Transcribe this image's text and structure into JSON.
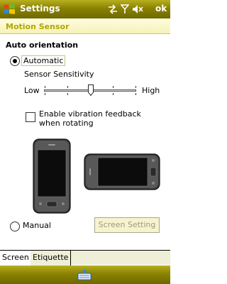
{
  "titlebar": {
    "app_title": "Settings",
    "ok_label": "ok",
    "icons": [
      "windows-start-icon",
      "connectivity-icon",
      "signal-icon",
      "volume-mute-icon"
    ]
  },
  "header": {
    "page_title": "Motion Sensor"
  },
  "auto_orientation": {
    "section_title": "Auto orientation",
    "automatic_label": "Automatic",
    "automatic_selected": true,
    "sensor_sensitivity_label": "Sensor Sensitivity",
    "low_label": "Low",
    "high_label": "High",
    "sensitivity_level": 0.5,
    "vibration_label": "Enable vibration feedback when rotating",
    "vibration_checked": false
  },
  "manual": {
    "manual_label": "Manual",
    "manual_selected": false,
    "screen_setting_label": "Screen Setting",
    "screen_setting_enabled": false
  },
  "tabs": [
    {
      "label": "Screen",
      "active": true
    },
    {
      "label": "Etiquette",
      "active": false
    }
  ],
  "colors": {
    "bar_accent": "#8a8200",
    "header_text": "#b3a600"
  }
}
